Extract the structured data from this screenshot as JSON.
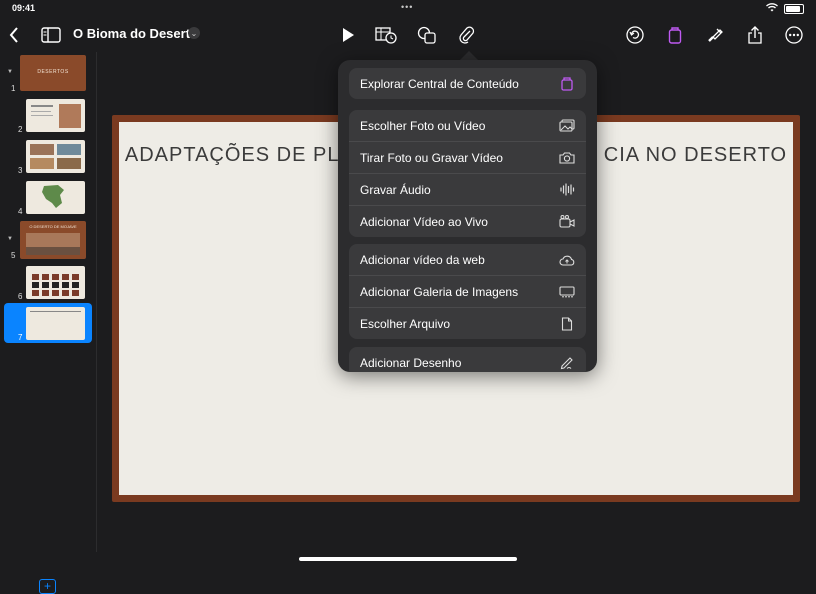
{
  "status": {
    "time": "09:41"
  },
  "toolbar": {
    "doc_title": "O Bioma do Deserto"
  },
  "sidebar": {
    "slides": [
      {
        "num": "1",
        "label": "DESERTOS"
      },
      {
        "num": "2",
        "label": ""
      },
      {
        "num": "3",
        "label": ""
      },
      {
        "num": "4",
        "label": ""
      },
      {
        "num": "5",
        "label": "O DESERTO DE MOJAVE"
      },
      {
        "num": "6",
        "label": ""
      },
      {
        "num": "7",
        "label": ""
      }
    ]
  },
  "slide": {
    "title_left": "ADAPTAÇÕES DE PLA",
    "title_right": "CIA NO DESERTO"
  },
  "menu": {
    "group1": [
      {
        "label": "Explorar Central de Conteúdo",
        "icon": "content-hub-icon"
      }
    ],
    "group2": [
      {
        "label": "Escolher Foto ou Vídeo",
        "icon": "photo-library-icon"
      },
      {
        "label": "Tirar Foto ou Gravar Vídeo",
        "icon": "camera-icon"
      },
      {
        "label": "Gravar Áudio",
        "icon": "waveform-icon"
      },
      {
        "label": "Adicionar Vídeo ao Vivo",
        "icon": "live-video-icon"
      }
    ],
    "group3": [
      {
        "label": "Adicionar vídeo da web",
        "icon": "cloud-icon"
      },
      {
        "label": "Adicionar Galeria de Imagens",
        "icon": "image-gallery-icon"
      },
      {
        "label": "Escolher Arquivo",
        "icon": "document-icon"
      }
    ],
    "group4": [
      {
        "label": "Adicionar Desenho",
        "icon": "pencil-draw-icon"
      }
    ]
  },
  "colors": {
    "accent": "#0a84ff",
    "highlight": "#bf5af2",
    "slide_border": "#7a3a20"
  }
}
